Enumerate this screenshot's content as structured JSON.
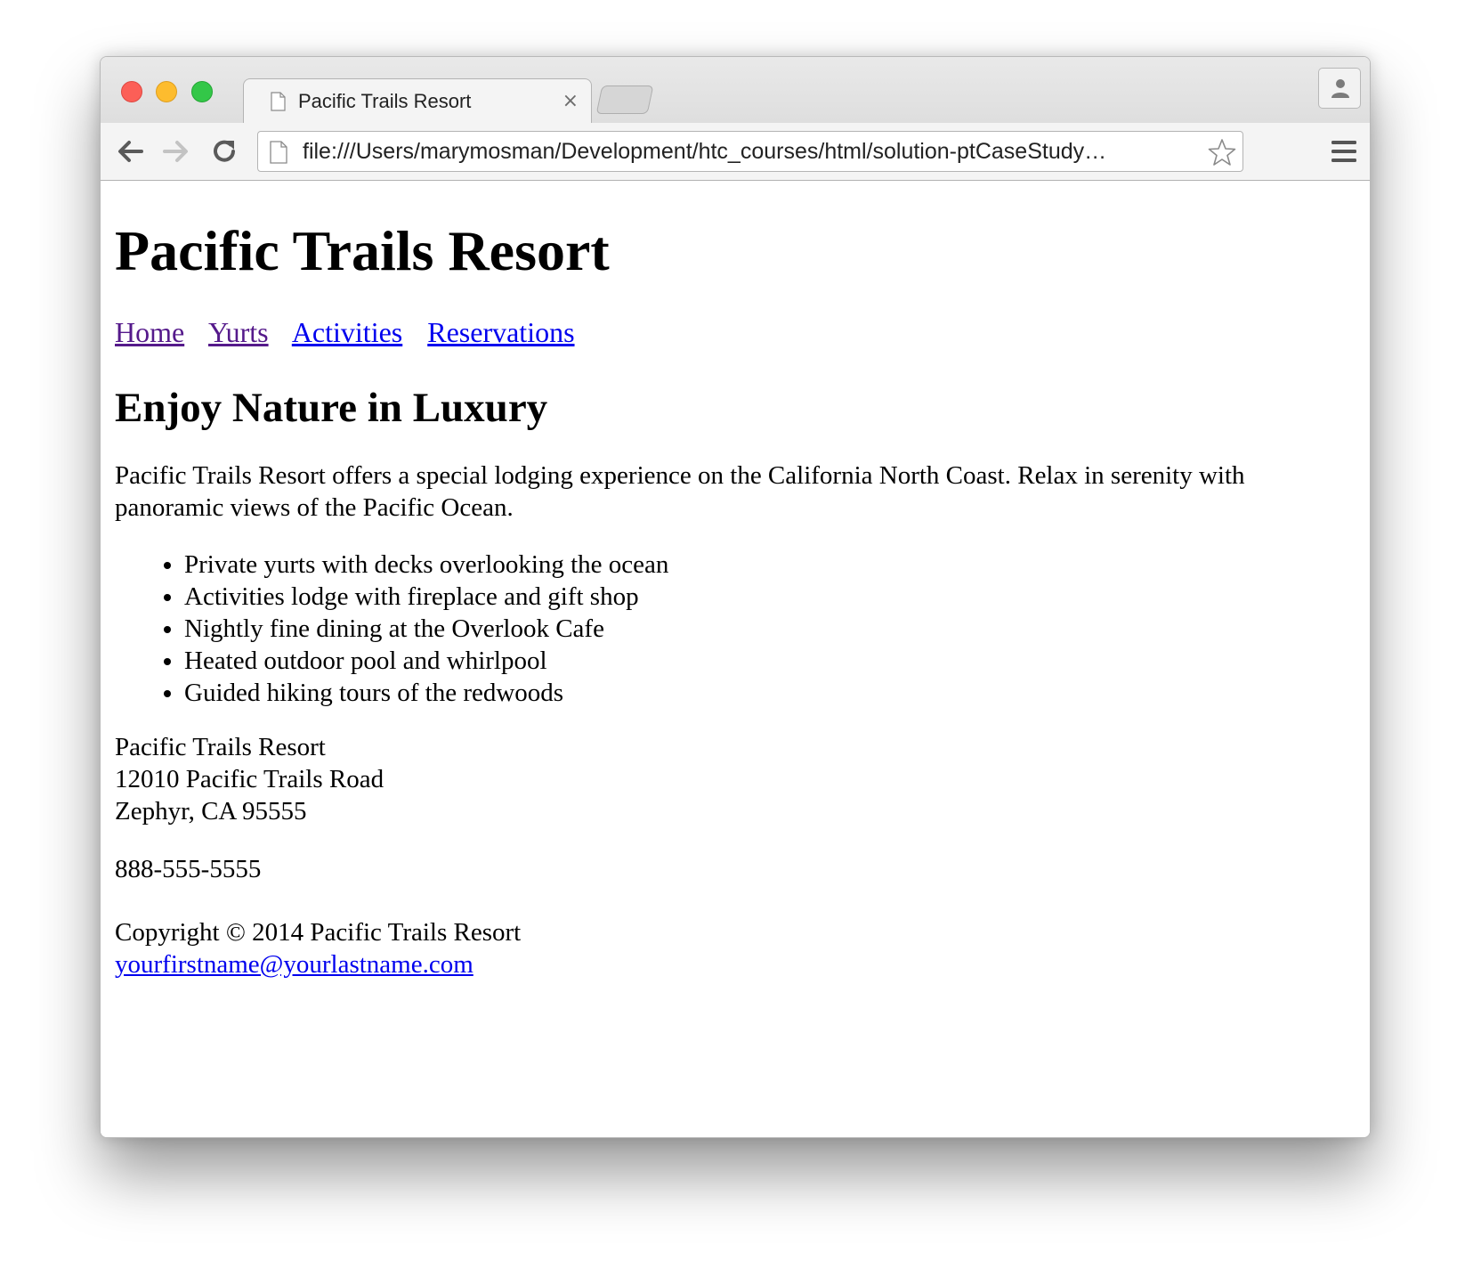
{
  "browser": {
    "tab_title": "Pacific Trails Resort",
    "tab_close": "×",
    "url": "file:///Users/marymosman/Development/htc_courses/html/solution-ptCaseStudy…"
  },
  "page": {
    "heading": "Pacific Trails Resort",
    "nav": [
      {
        "label": "Home",
        "visited": true
      },
      {
        "label": "Yurts",
        "visited": true
      },
      {
        "label": "Activities",
        "visited": false
      },
      {
        "label": "Reservations",
        "visited": false
      }
    ],
    "subheading": "Enjoy Nature in Luxury",
    "intro": "Pacific Trails Resort offers a special lodging experience on the California North Coast. Relax in serenity with panoramic views of the Pacific Ocean.",
    "features": [
      "Private yurts with decks overlooking the ocean",
      "Activities lodge with fireplace and gift shop",
      "Nightly fine dining at the Overlook Cafe",
      "Heated outdoor pool and whirlpool",
      "Guided hiking tours of the redwoods"
    ],
    "address": {
      "name": "Pacific Trails Resort",
      "street": "12010 Pacific Trails Road",
      "city": "Zephyr, CA 95555"
    },
    "phone": "888-555-5555",
    "footer": {
      "copyright": "Copyright © 2014 Pacific Trails Resort",
      "email": "yourfirstname@yourlastname.com"
    }
  },
  "colors": {
    "link_visited": "#551a8b",
    "link_unvisited": "#0000ee"
  }
}
